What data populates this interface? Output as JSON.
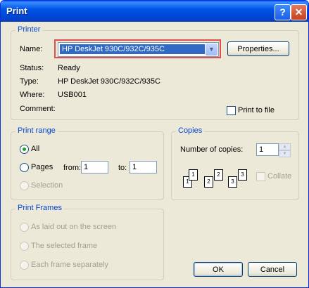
{
  "window": {
    "title": "Print",
    "help_btn": "?",
    "close_btn": "✕"
  },
  "printer": {
    "legend": "Printer",
    "name_label": "Name:",
    "name_value": "HP DeskJet 930C/932C/935C",
    "properties_label": "Properties...",
    "status_label": "Status:",
    "status_value": "Ready",
    "type_label": "Type:",
    "type_value": "HP DeskJet 930C/932C/935C",
    "where_label": "Where:",
    "where_value": "USB001",
    "comment_label": "Comment:",
    "print_to_file_label": "Print to file"
  },
  "print_range": {
    "legend": "Print range",
    "all_label": "All",
    "pages_label": "Pages",
    "from_label": "from:",
    "from_value": "1",
    "to_label": "to:",
    "to_value": "1",
    "selection_label": "Selection"
  },
  "copies": {
    "legend": "Copies",
    "number_label": "Number of copies:",
    "number_value": "1",
    "collate_label": "Collate",
    "page_numbers": [
      "1",
      "1",
      "2",
      "2",
      "3",
      "3"
    ]
  },
  "print_frames": {
    "legend": "Print Frames",
    "option1": "As laid out on the screen",
    "option2": "The selected frame",
    "option3": "Each frame separately"
  },
  "buttons": {
    "ok": "OK",
    "cancel": "Cancel"
  }
}
